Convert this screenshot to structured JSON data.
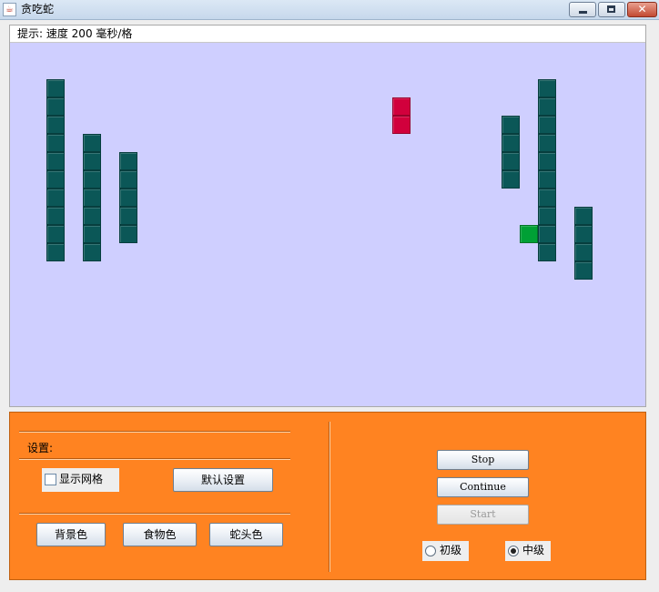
{
  "window": {
    "title": "贪吃蛇",
    "app_icon": "java-cup-icon"
  },
  "game": {
    "hint": "提示: 速度 200 毫秒/格",
    "colors": {
      "background": "#cfcfff",
      "wall": "#0b5757",
      "food": "#d1003c",
      "snake_head": "#00a035"
    },
    "grid_shown": false,
    "board_cells_cols": 35,
    "board_cells_rows": 20,
    "walls": [
      {
        "col": 2,
        "row": 2,
        "length": 10
      },
      {
        "col": 4,
        "row": 5,
        "length": 7
      },
      {
        "col": 6,
        "row": 6,
        "length": 5
      },
      {
        "col": 27,
        "row": 4,
        "length": 4
      },
      {
        "col": 29,
        "row": 2,
        "length": 10
      },
      {
        "col": 31,
        "row": 9,
        "length": 4
      }
    ],
    "food": [
      {
        "col": 21,
        "row": 3
      },
      {
        "col": 21,
        "row": 4
      }
    ],
    "snake": [
      {
        "col": 28,
        "row": 10
      }
    ]
  },
  "controls": {
    "settings_label": "设置:",
    "show_grid_label": "显示网格",
    "show_grid_checked": false,
    "default_settings": "默认设置",
    "bg_color": "背景色",
    "food_color": "食物色",
    "head_color": "蛇头色",
    "stop": "Stop",
    "continue": "Continue",
    "start": "Start",
    "level_beginner": "初级",
    "level_intermediate": "中级",
    "selected_level": "中级"
  }
}
